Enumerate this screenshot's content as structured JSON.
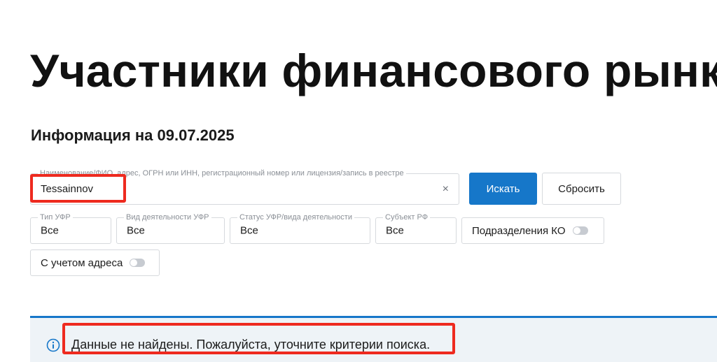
{
  "header": {
    "title": "Участники финансового рынка",
    "info_date": "Информация на 09.07.2025"
  },
  "search": {
    "label": "Наименование/ФИО, адрес, ОГРН или ИНН, регистрационный номер или лицензия/запись в реестре",
    "value": "Tessainnov",
    "clear_icon": "×",
    "search_button": "Искать",
    "reset_button": "Сбросить"
  },
  "filters": [
    {
      "label": "Тип УФР",
      "value": "Все"
    },
    {
      "label": "Вид деятельности УФР",
      "value": "Все"
    },
    {
      "label": "Статус УФР/вида деятельности",
      "value": "Все"
    },
    {
      "label": "Субъект РФ",
      "value": "Все"
    }
  ],
  "toggles": {
    "divisions": {
      "label": "Подразделения КО",
      "on": false
    },
    "address": {
      "label": "С учетом адреса",
      "on": false
    }
  },
  "result": {
    "icon": "info-icon",
    "message": "Данные не найдены. Пожалуйста, уточните критерии поиска."
  },
  "colors": {
    "accent": "#1677c9",
    "highlight": "#ee2a1f",
    "message_bg": "#eef3f7"
  }
}
